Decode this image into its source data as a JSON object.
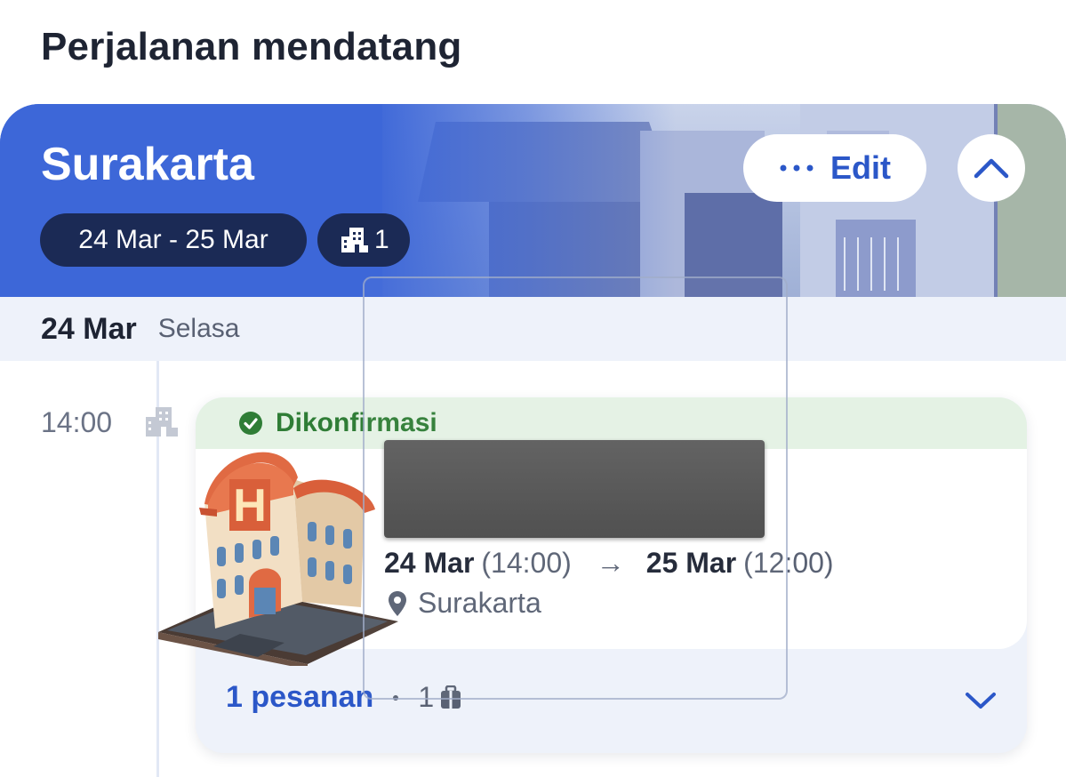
{
  "page": {
    "title": "Perjalanan mendatang"
  },
  "trip": {
    "city": "Surakarta",
    "dates": "24 Mar - 25 Mar",
    "bookings_count": "1",
    "edit_label": "Edit"
  },
  "day": {
    "date": "24 Mar",
    "weekday": "Selasa"
  },
  "event": {
    "time": "14:00",
    "status": "Dikonfirmasi",
    "check_in_date": "24 Mar",
    "check_in_time": "(14:00)",
    "arrow": "→",
    "check_out_date": "25 Mar",
    "check_out_time": "(12:00)",
    "location": "Surakarta"
  },
  "footer": {
    "orders": "1 pesanan",
    "items": "1"
  },
  "colors": {
    "accent": "#2b57c8",
    "banner": "#3d67d8",
    "confirmed": "#2f7d36",
    "chip": "#1b2a55"
  },
  "icons": [
    "more-dots-icon",
    "chevron-up-icon",
    "hotel-building-icon",
    "check-circle-icon",
    "map-pin-icon",
    "luggage-icon",
    "chevron-down-icon",
    "hotel-emoji-sticker"
  ]
}
